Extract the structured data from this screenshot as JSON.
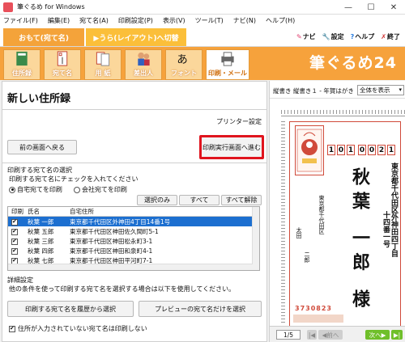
{
  "window": {
    "title": "筆ぐるめ for Windows",
    "minimize": "—",
    "maximize": "☐",
    "close": "✕"
  },
  "menu": [
    "ファイル(F)",
    "編集(E)",
    "宛て名(A)",
    "印刷設定(P)",
    "表示(V)",
    "ツール(T)",
    "ナビ(N)",
    "ヘルプ(H)"
  ],
  "modes": {
    "omote": "おもて(宛て名)",
    "ura": "▶うら(レイアウト)へ切替"
  },
  "toplinks": {
    "navi": "ナビ",
    "settings": "設定",
    "help": "ヘルプ",
    "exit": "終了"
  },
  "tools": [
    "住所録",
    "宛て名",
    "用 紙",
    "差出人",
    "フォント",
    "印刷・メール"
  ],
  "brand": "筆ぐるめ24",
  "left": {
    "title": "新しい住所録",
    "printer_settings": "プリンター設定",
    "back_button": "前の画面へ戻る",
    "exec_button": "印刷実行画面へ進む",
    "select_section": "印刷する宛て名の選択",
    "select_hint": "印刷する宛て名にチェックを入れてください",
    "radio_home": "自宅宛てを印刷",
    "radio_company": "会社宛てを印刷",
    "btn_select_only": "選択のみ",
    "btn_all": "すべて",
    "btn_clear_all": "すべて解除",
    "list_headers": {
      "print": "印刷",
      "name": "氏名",
      "address": "自宅住所"
    },
    "rows": [
      {
        "name": "秋葉 一郎",
        "address": "東京都千代田区外神田4丁目14番1号",
        "checked": true,
        "selected": true
      },
      {
        "name": "秋葉 五郎",
        "address": "東京都千代田区神田佐久間町5-1",
        "checked": true,
        "selected": false
      },
      {
        "name": "秋葉 三郎",
        "address": "東京都千代田区神田松永町3-1",
        "checked": true,
        "selected": false
      },
      {
        "name": "秋葉 四郎",
        "address": "東京都千代田区神田和泉町4-1",
        "checked": true,
        "selected": false
      },
      {
        "name": "秋葉 七郎",
        "address": "東京都千代田区神田平河町7-1",
        "checked": true,
        "selected": false
      }
    ],
    "detail_section": "詳細設定",
    "detail_hint": "他の条件を使って印刷する宛て名を選択する場合は以下を使用してください。",
    "btn_history": "印刷する宛て名を履歴から選択",
    "btn_preview_only": "プレビューの宛て名だけを選択",
    "chk_no_address": "住所が入力されていない宛て名は印刷しない"
  },
  "preview": {
    "header_text": "縦書き 縦書き１ - 年賀はがき",
    "display_select": "全体を表示",
    "zip": [
      "1",
      "0",
      "1",
      "0",
      "0",
      "2",
      "1"
    ],
    "address_line1": "東京都千代田区外神田四丁目",
    "address_line2": "十四番一号",
    "recipient": "秋葉 一郎 様",
    "sender_address": "東京都千代田区",
    "sender_name1": "太田",
    "sender_name2": "二郎",
    "sender_zip": "3730823",
    "page": "1/5",
    "prev": "前へ",
    "next": "次へ"
  },
  "colors": {
    "orange": "#f6a23c",
    "exec_border": "#e0141e",
    "select_blue": "#1c6fd0",
    "card_red": "#d04a3a",
    "nav_green": "#6fbf2a"
  }
}
